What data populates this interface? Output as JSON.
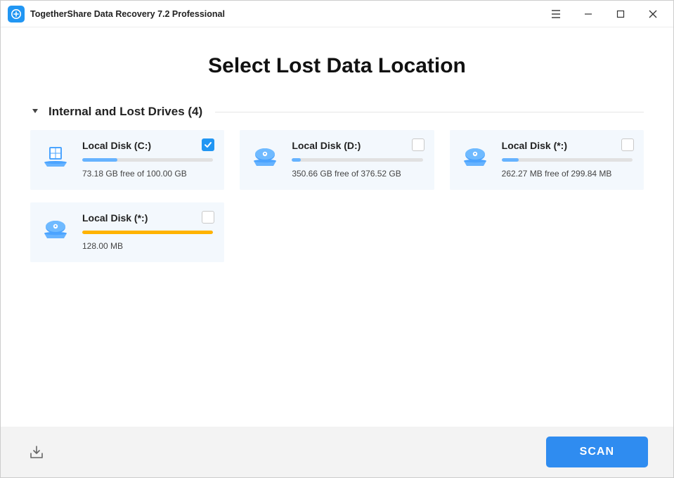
{
  "app": {
    "title": "TogetherShare Data Recovery 7.2 Professional"
  },
  "page": {
    "heading": "Select Lost Data Location"
  },
  "section": {
    "title": "Internal and Lost Drives (4)"
  },
  "drives": [
    {
      "name": "Local Disk (C:)",
      "free": "73.18 GB free of 100.00 GB",
      "used_pct": 27,
      "checked": true,
      "icon": "windows",
      "warn": false
    },
    {
      "name": "Local Disk (D:)",
      "free": "350.66 GB free of 376.52 GB",
      "used_pct": 7,
      "checked": false,
      "icon": "disk",
      "warn": false
    },
    {
      "name": "Local Disk (*:)",
      "free": "262.27 MB free of 299.84 MB",
      "used_pct": 13,
      "checked": false,
      "icon": "disk",
      "warn": false
    },
    {
      "name": "Local Disk (*:)",
      "free": "128.00 MB",
      "used_pct": 100,
      "checked": false,
      "icon": "disk",
      "warn": true
    }
  ],
  "footer": {
    "scan_label": "SCAN"
  }
}
